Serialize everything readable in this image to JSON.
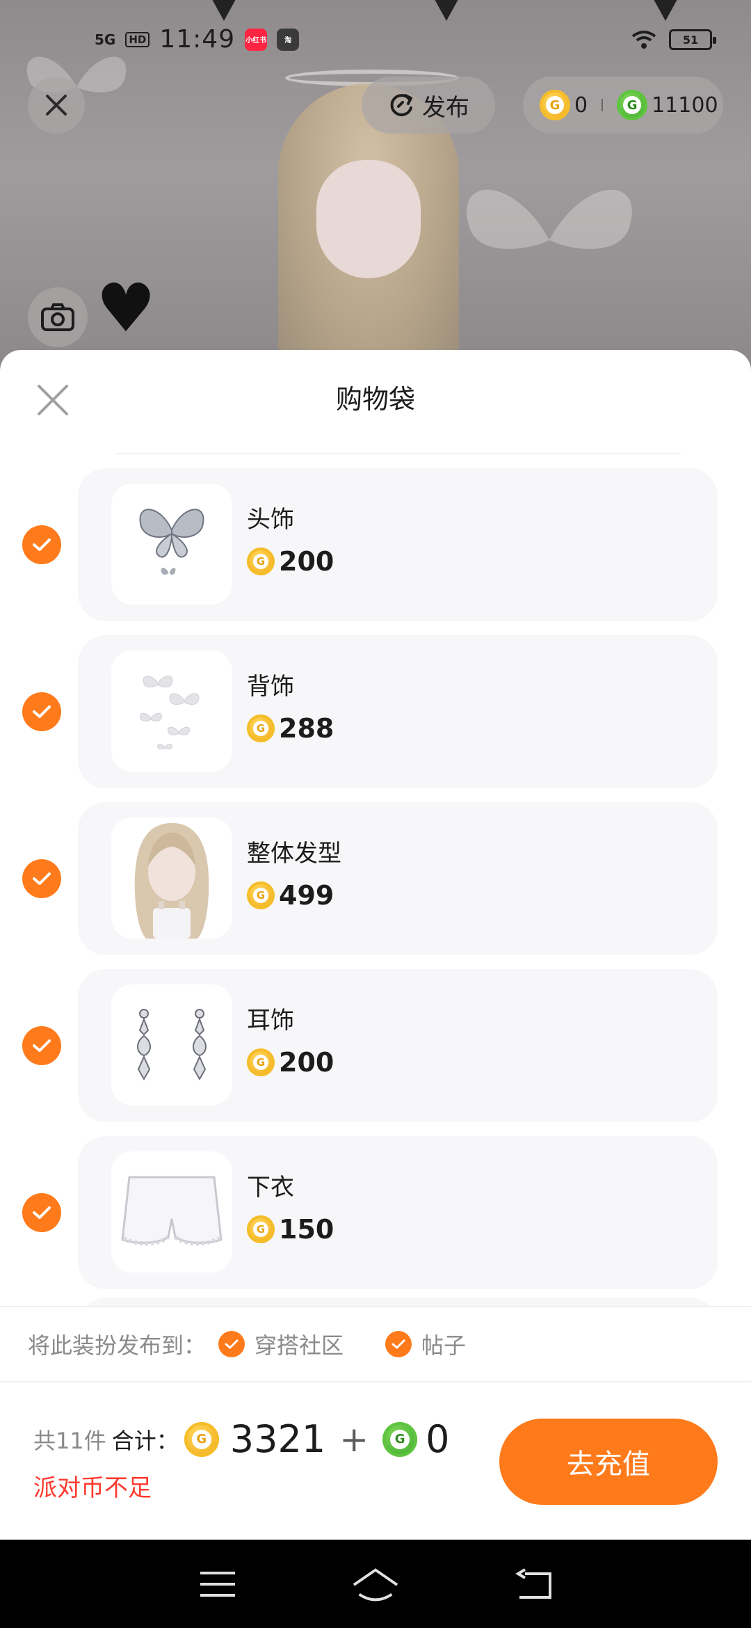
{
  "status_bar": {
    "network": "5G",
    "hd": "HD",
    "time": "11:49",
    "app_badges": [
      "小红书",
      "淘"
    ],
    "battery": "51"
  },
  "top": {
    "publish_label": "发布",
    "gold_balance": "0",
    "green_balance": "11100"
  },
  "sheet": {
    "title": "购物袋",
    "items": [
      {
        "name": "头饰",
        "price": "200",
        "thumb": "butterfly-hairpin"
      },
      {
        "name": "背饰",
        "price": "288",
        "thumb": "butterfly-back"
      },
      {
        "name": "整体发型",
        "price": "499",
        "thumb": "hairstyle"
      },
      {
        "name": "耳饰",
        "price": "200",
        "thumb": "earrings"
      },
      {
        "name": "下衣",
        "price": "150",
        "thumb": "shorts"
      }
    ],
    "publish_to": {
      "label": "将此装扮发布到：",
      "options": [
        "穿搭社区",
        "帖子"
      ]
    }
  },
  "footer": {
    "count": "共11件",
    "total_label": "合计：",
    "gold_total": "3321",
    "plus": "+",
    "green_total": "0",
    "warning": "派对币不足",
    "recharge_label": "去充值"
  },
  "colors": {
    "accent": "#ff7a1a",
    "warning": "#ff3b30",
    "card_bg": "#f7f7f9",
    "gold_coin": "#f0a813",
    "green_coin": "#3aa62a"
  }
}
